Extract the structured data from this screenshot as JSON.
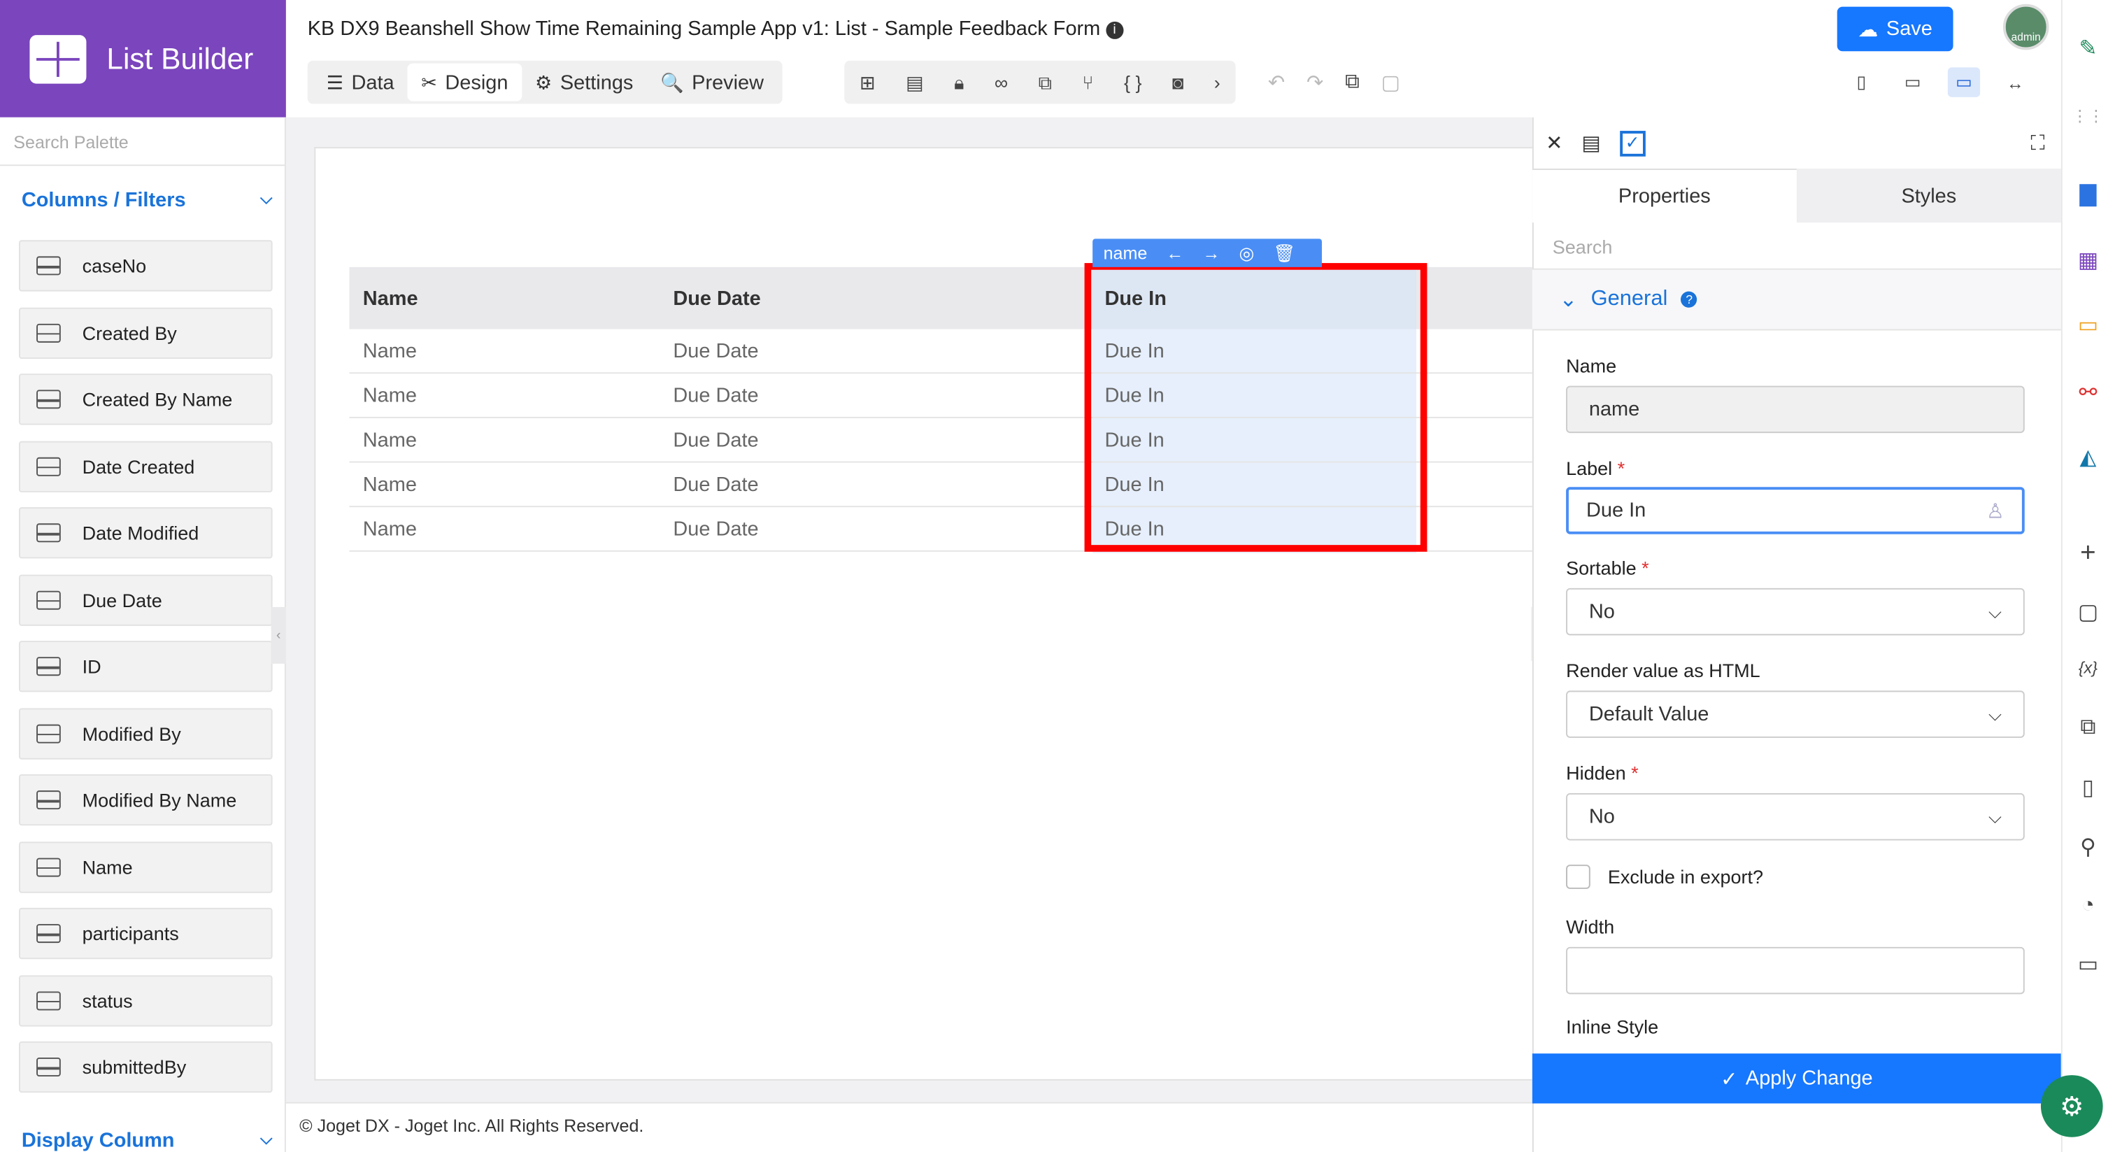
{
  "header": {
    "brand": "List Builder",
    "app_title": "KB DX9 Beanshell Show Time Remaining Sample App v1: List - Sample Feedback Form",
    "info_icon": "i",
    "tabs": [
      {
        "label": "Data",
        "icon": "data-icon"
      },
      {
        "label": "Design",
        "icon": "design-icon"
      },
      {
        "label": "Settings",
        "icon": "gear-icon"
      },
      {
        "label": "Preview",
        "icon": "preview-icon"
      }
    ],
    "active_tab": "Design",
    "save_label": "Save",
    "avatar_text": "admin"
  },
  "palette": {
    "search_placeholder": "Search Palette",
    "columns_section": "Columns / Filters",
    "columns": [
      "caseNo",
      "Created By",
      "Created By Name",
      "Date Created",
      "Date Modified",
      "Due Date",
      "ID",
      "Modified By",
      "Modified By Name",
      "Name",
      "participants",
      "status",
      "submittedBy"
    ],
    "display_section": "Display Column"
  },
  "table": {
    "headers": [
      "Name",
      "Due Date",
      "Due In"
    ],
    "rows": [
      [
        "Name",
        "Due Date",
        "Due In"
      ],
      [
        "Name",
        "Due Date",
        "Due In"
      ],
      [
        "Name",
        "Due Date",
        "Due In"
      ],
      [
        "Name",
        "Due Date",
        "Due In"
      ],
      [
        "Name",
        "Due Date",
        "Due In"
      ]
    ],
    "selected_tool_label": "name"
  },
  "footer": "© Joget DX - Joget Inc. All Rights Reserved.",
  "properties": {
    "tabs": [
      "Properties",
      "Styles"
    ],
    "search_placeholder": "Search",
    "section": "General",
    "fields": {
      "name_label": "Name",
      "name_value": "name",
      "label_label": "Label",
      "label_value": "Due In",
      "sortable_label": "Sortable",
      "sortable_value": "No",
      "render_label": "Render value as HTML",
      "render_value": "Default Value",
      "hidden_label": "Hidden",
      "hidden_value": "No",
      "exclude_label": "Exclude in export?",
      "width_label": "Width",
      "width_value": "",
      "inline_label": "Inline Style"
    },
    "apply_label": "Apply Change"
  },
  "colors": {
    "brand": "#7b45bd",
    "primary": "#1677ff",
    "highlight": "#ff0000"
  }
}
